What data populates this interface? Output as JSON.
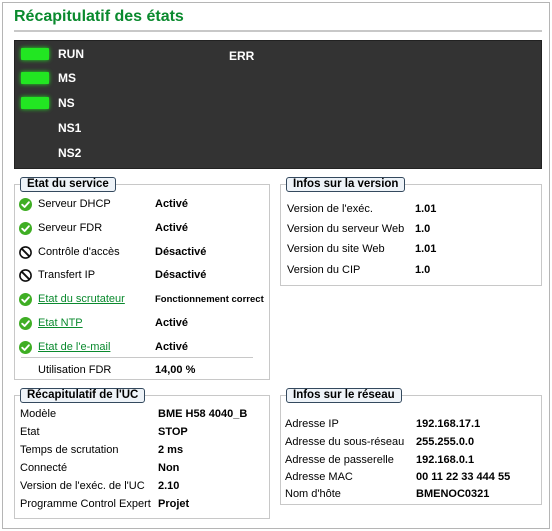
{
  "page": {
    "title": "Récapitulatif des états"
  },
  "leds": [
    {
      "label": "RUN",
      "on": true
    },
    {
      "label": "MS",
      "on": true
    },
    {
      "label": "NS",
      "on": true
    },
    {
      "label": "NS1",
      "on": false
    },
    {
      "label": "NS2",
      "on": false
    }
  ],
  "err_label": "ERR",
  "colors": {
    "led_on": "#22e622",
    "title": "#0a8a2e",
    "panel_bg": "#333333",
    "ok_icon": "#3fae24",
    "link": "#0a8a2e"
  },
  "service": {
    "title": "Etat du service",
    "rows": [
      {
        "name": "Serveur DHCP",
        "value": "Activé",
        "icon": "check-icon",
        "link": false
      },
      {
        "name": "Serveur FDR",
        "value": "Activé",
        "icon": "check-icon",
        "link": false
      },
      {
        "name": "Contrôle d'accès",
        "value": "Désactivé",
        "icon": "disabled-icon",
        "link": false
      },
      {
        "name": "Transfert IP",
        "value": "Désactivé",
        "icon": "disabled-icon",
        "link": false
      },
      {
        "name": "Etat du scrutateur",
        "value": "Fonctionnement correct",
        "icon": "check-icon",
        "link": true
      },
      {
        "name": "Etat NTP",
        "value": "Activé",
        "icon": "check-icon",
        "link": true
      },
      {
        "name": "Etat de l'e-mail",
        "value": "Activé",
        "icon": "check-icon",
        "link": true
      }
    ],
    "fdr_usage": {
      "name": "Utilisation FDR",
      "value": "14,00 %"
    }
  },
  "version": {
    "title": "Infos sur la version",
    "rows": [
      {
        "name": "Version de l'exéc.",
        "value": "1.01"
      },
      {
        "name": "Version du serveur Web",
        "value": "1.0"
      },
      {
        "name": "Version du site Web",
        "value": "1.01"
      },
      {
        "name": "Version du CIP",
        "value": "1.0"
      }
    ]
  },
  "cpu": {
    "title": "Récapitulatif de l'UC",
    "rows": [
      {
        "name": "Modèle",
        "value": "BME H58 4040_B"
      },
      {
        "name": "Etat",
        "value": "STOP"
      },
      {
        "name": "Temps de scrutation",
        "value": "2 ms"
      },
      {
        "name": "Connecté",
        "value": "Non"
      },
      {
        "name": "Version de l'exéc. de l'UC",
        "value": "2.10"
      },
      {
        "name": "Programme Control Expert",
        "value": "Projet"
      }
    ]
  },
  "network": {
    "title": "Infos sur le réseau",
    "rows": [
      {
        "name": "Adresse IP",
        "value": "192.168.17.1"
      },
      {
        "name": "Adresse du sous-réseau",
        "value": "255.255.0.0"
      },
      {
        "name": "Adresse de passerelle",
        "value": "192.168.0.1"
      },
      {
        "name": "Adresse MAC",
        "value": "00 11 22 33 444 55"
      },
      {
        "name": "Nom d'hôte",
        "value": "BMENOC0321"
      }
    ]
  }
}
